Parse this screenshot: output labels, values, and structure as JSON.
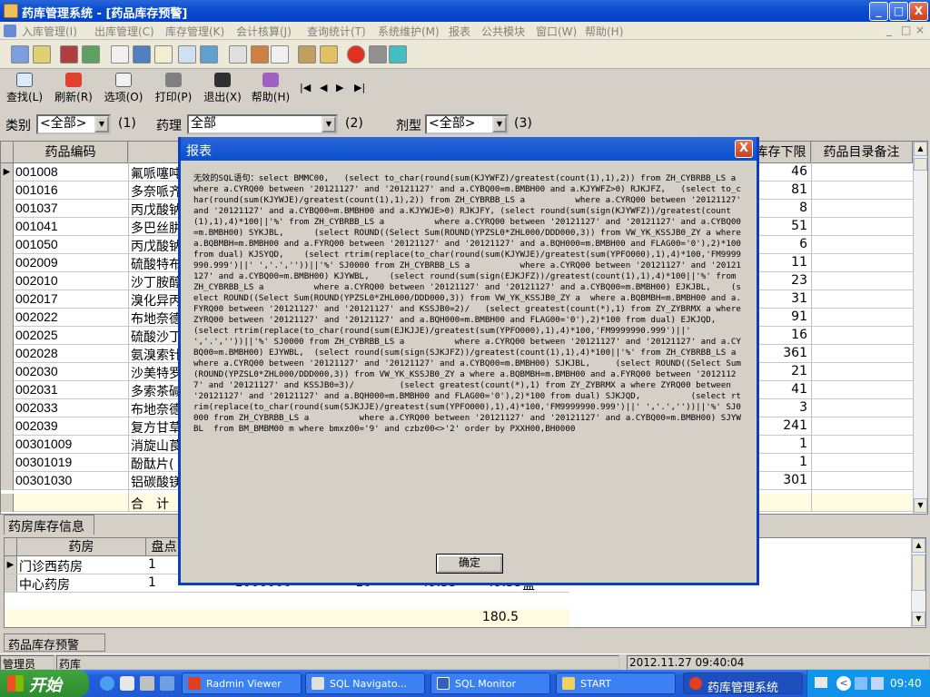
{
  "window": {
    "title": "药库管理系统 - [药品库存预警]",
    "min_label": "_",
    "max_label": "□",
    "close_label": "X"
  },
  "menu": [
    {
      "label": "入库管理(I)",
      "dim": true
    },
    {
      "label": "出库管理(C)",
      "dim": true
    },
    {
      "label": "库存管理(K)",
      "dim": true
    },
    {
      "label": "会计核算(J)",
      "dim": true
    },
    {
      "label": "查询统计(T)",
      "dim": true
    },
    {
      "label": "系统维护(M)",
      "dim": true
    },
    {
      "label": "报表",
      "dim": true
    },
    {
      "label": "公共模块",
      "dim": true
    },
    {
      "label": "窗口(W)",
      "dim": true
    },
    {
      "label": "帮助(H)",
      "dim": true
    }
  ],
  "toolbar2": {
    "find": "查找(L)",
    "refresh": "刷新(R)",
    "options": "选项(O)",
    "print": "打印(P)",
    "exit": "退出(X)",
    "help": "帮助(H)",
    "nav_first": "|◀",
    "nav_prev": "◀",
    "nav_next": "▶",
    "nav_last": "▶|"
  },
  "filter": {
    "category_label": "类别",
    "category_value": "<全部>",
    "category_num": "(1)",
    "pharm_label": "药理",
    "pharm_value": "全部",
    "pharm_num": "(2)",
    "form_label": "剂型",
    "form_value": "<全部>",
    "form_num": "(3)"
  },
  "grid": {
    "headers": {
      "code": "药品编码",
      "min_stock": "库存下限",
      "note": "药品目录备注"
    },
    "rows": [
      {
        "code": "001008",
        "name": "氟哌噻吨",
        "min": "46"
      },
      {
        "code": "001016",
        "name": "多奈哌齐",
        "min": "81"
      },
      {
        "code": "001037",
        "name": "丙戊酸钠",
        "min": "8"
      },
      {
        "code": "001041",
        "name": "多巴丝肼",
        "min": "51"
      },
      {
        "code": "001050",
        "name": "丙戊酸钠",
        "min": "6"
      },
      {
        "code": "002009",
        "name": "硫酸特布",
        "min": "11"
      },
      {
        "code": "002010",
        "name": "沙丁胺醇",
        "min": "23"
      },
      {
        "code": "002017",
        "name": "溴化异丙",
        "min": "31"
      },
      {
        "code": "002022",
        "name": "布地奈德",
        "min": "91"
      },
      {
        "code": "002025",
        "name": "硫酸沙丁",
        "min": "16"
      },
      {
        "code": "002028",
        "name": "氨溴索针",
        "min": "361"
      },
      {
        "code": "002030",
        "name": "沙美特罗",
        "min": "21"
      },
      {
        "code": "002031",
        "name": "多索茶碱",
        "min": "41"
      },
      {
        "code": "002033",
        "name": "布地奈德",
        "min": "3"
      },
      {
        "code": "002039",
        "name": "复方甘草",
        "min": "241"
      },
      {
        "code": "00301009",
        "name": "消旋山莨",
        "min": "1"
      },
      {
        "code": "00301019",
        "name": "酚酞片(",
        "min": "1"
      },
      {
        "code": "00301030",
        "name": "铝碳酸镁",
        "min": "301"
      }
    ],
    "total_label": "合　计"
  },
  "lower": {
    "tab_label": "药房库存信息",
    "headers": {
      "pharmacy": "药房",
      "count": "盘点"
    },
    "rows": [
      {
        "pharmacy": "门诊西药房",
        "count": "1",
        "c3": "",
        "c4": "",
        "c5": "",
        "c6": "",
        "c7": ""
      },
      {
        "pharmacy": "中心药房",
        "count": "1",
        "c3": "1000000",
        "c4": "10",
        "c5": "49.35",
        "c6": "49.35",
        "c7": "盒"
      }
    ],
    "sum_value": "180.5",
    "bottom_tab": "药品库存预警"
  },
  "status": {
    "user": "管理员",
    "dept": "药库",
    "datetime": "2012.11.27 09:40:04"
  },
  "taskbar": {
    "start": "开始",
    "tasks": [
      "Radmin Viewer",
      "SQL Navigato...",
      "SQL Monitor",
      "START",
      "药库管理系统"
    ],
    "clock": "09:40"
  },
  "dialog": {
    "title": "报表",
    "close": "X",
    "message": "无效的SQL语句：select BMMC00,   (select to_char(round(sum(KJYWFZ)/greatest(count(1),1),2)) from ZH_CYBRBB_LS a          where a.CYRQ00 between '20121127' and '20121127' and a.CYBQ00=m.BMBH00 and a.KJYWFZ>0) RJKJFZ,   (select to_char(round(sum(KJYWJE)/greatest(count(1),1),2)) from ZH_CYBRBB_LS a          where a.CYRQ00 between '20121127' and '20121127' and a.CYBQ00=m.BMBH00 and a.KJYWJE>0) RJKJFY, (select round(sum(sign(KJYWFZ))/greatest(count(1),1),4)*100||'%' from ZH_CYBRBB_LS a          where a.CYRQ00 between '20121127' and '20121127' and a.CYBQ00=m.BMBH00) SYKJBL,      (select ROUND((Select Sum(ROUND(YPZSL0*ZHL000/DDD000,3)) from VW_YK_KSSJB0_ZY a where a.BQBMBH=m.BMBH00 and a.FYRQ00 between '20121127' and '20121127' and a.BQH000=m.BMBH00 and FLAG00='0'),2)*100 from dual) KJSYQD,    (select rtrim(replace(to_char(round(sum(KJYWJE)/greatest(sum(YPFO000),1),4)*100,'FM9999990.999')||' ','.',''))||'%' SJ0000 from ZH_CYBRBB_LS a          where a.CYRQ00 between '20121127' and '20121127' and a.CYBQ00=m.BMBH00) KJYWBL,    (select round(sum(sign(EJKJFZ))/greatest(count(1),1),4)*100||'%' from ZH_CYBRBB_LS a          where a.CYRQ00 between '20121127' and '20121127' and a.CYBQ00=m.BMBH00) EJKJBL,    (select ROUND((Select Sum(ROUND(YPZSL0*ZHL000/DDD000,3)) from VW_YK_KSSJB0_ZY a  where a.BQBMBH=m.BMBH00 and a.FYRQ00 between '20121127' and '20121127' and KSSJB0=2)/   (select greatest(count(*),1) from ZY_ZYBRMX a where ZYRQ00 between '20121127' and '20121127' and a.BQH000=m.BMBH00 and FLAG00='0'),2)*100 from dual) EJKJQD,         (select rtrim(replace(to_char(round(sum(EJKJJE)/greatest(sum(YPFO000),1),4)*100,'FM9999990.999')||' ','.',''))||'%' SJ0000 from ZH_CYBRBB_LS a          where a.CYRQ00 between '20121127' and '20121127' and a.CYBQ00=m.BMBH00) EJYWBL,  (select round(sum(sign(SJKJFZ))/greatest(count(1),1),4)*100||'%' from ZH_CYBRBB_LS a          where a.CYRQ00 between '20121127' and '20121127' and a.CYBQ00=m.BMBH00) SJKJBL,     (select ROUND((Select Sum(ROUND(YPZSL0*ZHL000/DDD000,3)) from VW_YK_KSSJB0_ZY a where a.BQBMBH=m.BMBH00 and a.FYRQ00 between '20121127' and '20121127' and KSSJB0=3)/         (select greatest(count(*),1) from ZY_ZYBRMX a where ZYRQ00 between '20121127' and '20121127' and a.BQH000=m.BMBH00 and FLAG00='0'),2)*100 from dual) SJKJQD,          (select rtrim(replace(to_char(round(sum(SJKJJE)/greatest(sum(YPFO000),1),4)*100,'FM9999990.999')||' ','.',''))||'%' SJ0000 from ZH_CYBRBB_LS a          where a.CYRQ00 between '20121127' and '20121127' and a.CYBQ00=m.BMBH00) SJYWBL  from BM_BMBM00 m where bmxz00='9' and czbz00<>'2' order by PXXH00,BH0000",
    "ok": "确定"
  }
}
